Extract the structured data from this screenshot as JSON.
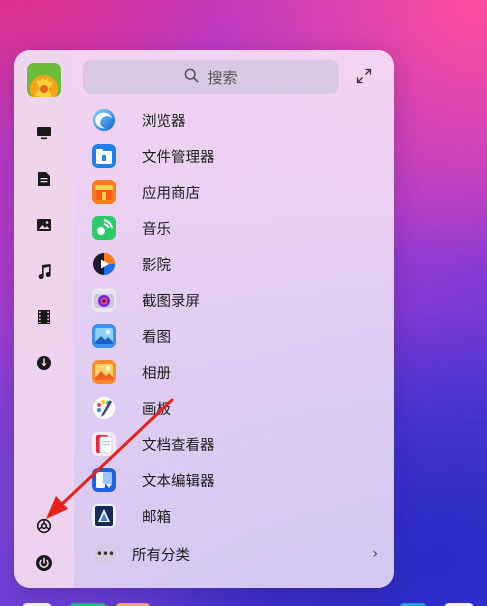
{
  "search": {
    "placeholder": "搜索"
  },
  "sidebar": {
    "icons": [
      "monitor-icon",
      "document-icon",
      "image-icon",
      "music-icon",
      "film-icon",
      "download-icon",
      "settings-icon",
      "power-icon"
    ]
  },
  "apps": [
    {
      "label": "浏览器",
      "icon": "browser-icon"
    },
    {
      "label": "文件管理器",
      "icon": "file-manager-icon"
    },
    {
      "label": "应用商店",
      "icon": "app-store-icon"
    },
    {
      "label": "音乐",
      "icon": "music-app-icon"
    },
    {
      "label": "影院",
      "icon": "movie-app-icon"
    },
    {
      "label": "截图录屏",
      "icon": "screenshot-icon"
    },
    {
      "label": "看图",
      "icon": "image-viewer-icon"
    },
    {
      "label": "相册",
      "icon": "album-icon"
    },
    {
      "label": "画板",
      "icon": "draw-icon"
    },
    {
      "label": "文档查看器",
      "icon": "document-viewer-icon"
    },
    {
      "label": "文本编辑器",
      "icon": "text-editor-icon"
    },
    {
      "label": "邮箱",
      "icon": "mail-icon"
    }
  ],
  "all_categories": {
    "label": "所有分类",
    "chevron": "›"
  },
  "colors": {
    "annotation_arrow": "#e8211c",
    "menu_bg": "#ecdaf2",
    "sidebar_bg": "#eed4ec"
  }
}
